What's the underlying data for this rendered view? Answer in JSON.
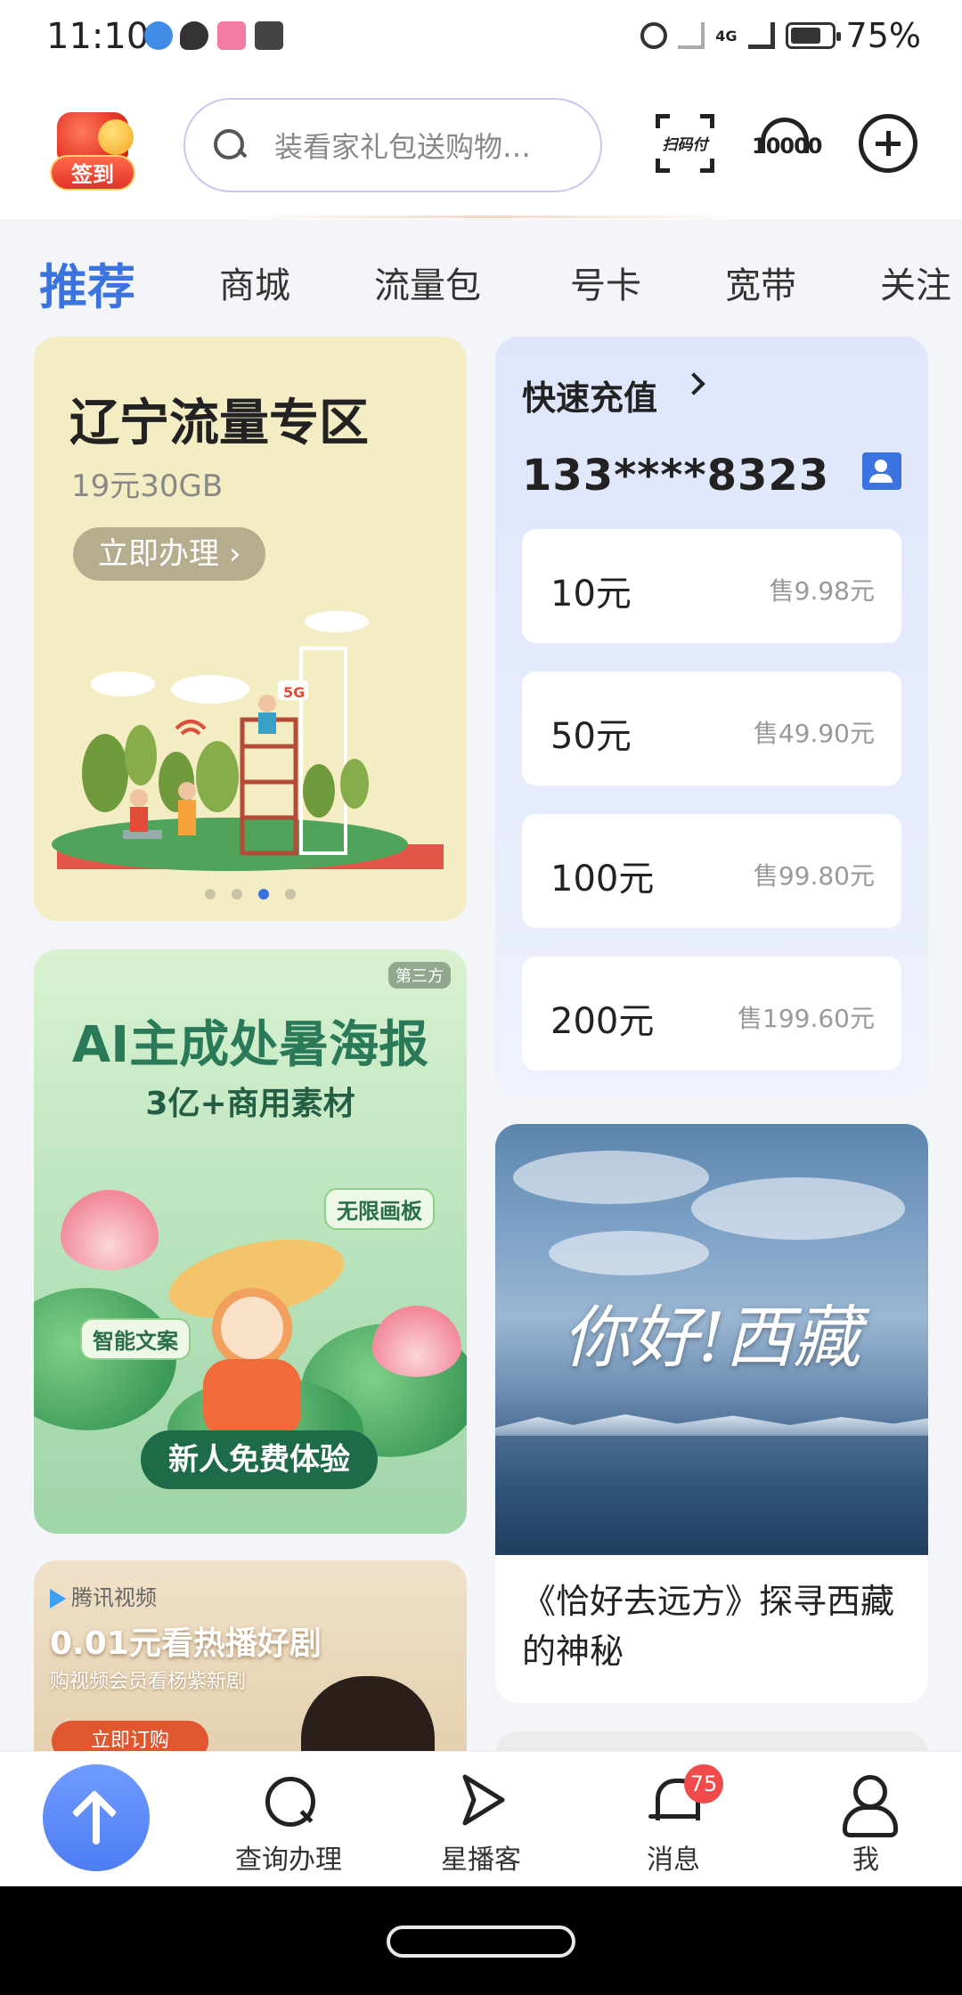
{
  "status_bar": {
    "time": "11:10",
    "battery": "75%",
    "battery_level_percent": 75,
    "network": "4G"
  },
  "header": {
    "signin_label": "签到",
    "search_placeholder": "装看家礼包送购物…",
    "scan_pay_label": "扫码付",
    "service_label": "10000"
  },
  "tabs": [
    {
      "label": "推荐",
      "active": true
    },
    {
      "label": "商城",
      "active": false
    },
    {
      "label": "流量包",
      "active": false
    },
    {
      "label": "号卡",
      "active": false
    },
    {
      "label": "宽带",
      "active": false
    },
    {
      "label": "关注",
      "active": false
    }
  ],
  "promo_card": {
    "title": "辽宁流量专区",
    "subtitle": "19元30GB",
    "button": "立即办理",
    "illustration_label": "5G",
    "carousel_total": 4,
    "carousel_active_index": 2
  },
  "recharge": {
    "title": "快速充值",
    "phone": "133****8323",
    "options": [
      {
        "amount": "10元",
        "price": "售9.98元"
      },
      {
        "amount": "50元",
        "price": "售49.90元"
      },
      {
        "amount": "100元",
        "price": "售99.80元"
      },
      {
        "amount": "200元",
        "price": "售199.60元"
      }
    ]
  },
  "ai_card": {
    "badge": "第三方",
    "title": "AI主成处暑海报",
    "subtitle": "3亿+商用素材",
    "tag_1": "无限画板",
    "tag_2": "智能文案",
    "cta": "新人免费体验"
  },
  "tencent_card": {
    "brand": "腾讯视频",
    "title": "0.01元看热播好剧",
    "subtitle": "购视频会员看杨紫新剧",
    "button": "立即订购"
  },
  "tibet_card": {
    "image_caption": "你好!西藏",
    "text": "《恰好去远方》探寻西藏的神秘"
  },
  "bottom_nav": {
    "items": [
      {
        "label": "查询办理",
        "icon": "search-icon"
      },
      {
        "label": "星播客",
        "icon": "play-arrow-icon"
      },
      {
        "label": "消息",
        "icon": "bell-icon",
        "badge": "75"
      },
      {
        "label": "我",
        "icon": "person-icon"
      }
    ]
  },
  "colors": {
    "accent": "#3b73e0",
    "badge": "#f04a4a"
  }
}
